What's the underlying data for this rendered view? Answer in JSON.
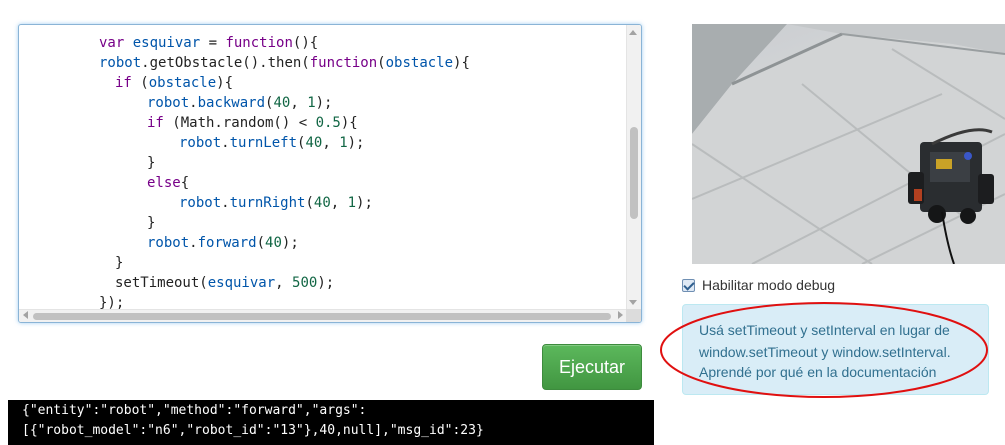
{
  "editor": {
    "lines": [
      [
        [
          "var ",
          "kw"
        ],
        [
          "esquivar",
          "vd"
        ],
        [
          " = ",
          "pl"
        ],
        [
          "function",
          "kw"
        ],
        [
          "(){",
          "pl"
        ]
      ],
      [
        [
          "robot",
          "vn"
        ],
        [
          ".getObstacle().then(",
          "pl"
        ],
        [
          "function",
          "kw"
        ],
        [
          "(",
          "pl"
        ],
        [
          "obstacle",
          "vd"
        ],
        [
          "){",
          "pl"
        ]
      ],
      [
        [
          "if",
          "kw"
        ],
        [
          " (",
          "pl"
        ],
        [
          "obstacle",
          "vn"
        ],
        [
          "){",
          "pl"
        ]
      ],
      [
        [
          "robot",
          "vn"
        ],
        [
          ".",
          "pl"
        ],
        [
          "backward",
          "pr"
        ],
        [
          "(",
          "pl"
        ],
        [
          "40",
          "nm"
        ],
        [
          ", ",
          "pl"
        ],
        [
          "1",
          "nm"
        ],
        [
          ");",
          "pl"
        ]
      ],
      [
        [
          "if",
          "kw"
        ],
        [
          " (Math.random() < ",
          "pl"
        ],
        [
          "0.5",
          "nm"
        ],
        [
          "){",
          "pl"
        ]
      ],
      [
        [
          "robot",
          "vn"
        ],
        [
          ".",
          "pl"
        ],
        [
          "turnLeft",
          "pr"
        ],
        [
          "(",
          "pl"
        ],
        [
          "40",
          "nm"
        ],
        [
          ", ",
          "pl"
        ],
        [
          "1",
          "nm"
        ],
        [
          ");",
          "pl"
        ]
      ],
      [
        [
          "}",
          "pl"
        ]
      ],
      [
        [
          "else",
          "kw"
        ],
        [
          "{",
          "pl"
        ]
      ],
      [
        [
          "robot",
          "vn"
        ],
        [
          ".",
          "pl"
        ],
        [
          "turnRight",
          "pr"
        ],
        [
          "(",
          "pl"
        ],
        [
          "40",
          "nm"
        ],
        [
          ", ",
          "pl"
        ],
        [
          "1",
          "nm"
        ],
        [
          ");",
          "pl"
        ]
      ],
      [
        [
          "}",
          "pl"
        ]
      ],
      [
        [
          "robot",
          "vn"
        ],
        [
          ".",
          "pl"
        ],
        [
          "forward",
          "pr"
        ],
        [
          "(",
          "pl"
        ],
        [
          "40",
          "nm"
        ],
        [
          ");",
          "pl"
        ]
      ],
      [
        [
          "}",
          "pl"
        ]
      ],
      [
        [
          "setTimeout(",
          "pl"
        ],
        [
          "esquivar",
          "vn"
        ],
        [
          ", ",
          "pl"
        ],
        [
          "500",
          "nm"
        ],
        [
          ");",
          "pl"
        ]
      ],
      [
        [
          "});",
          "pl"
        ]
      ]
    ]
  },
  "run_button": {
    "label": "Ejecutar"
  },
  "console": {
    "lines": [
      "{\"entity\":\"robot\",\"method\":\"forward\",\"args\":",
      "[{\"robot_model\":\"n6\",\"robot_id\":\"13\"},40,null],\"msg_id\":23}"
    ]
  },
  "debug": {
    "label": "Habilitar modo debug",
    "checked": true
  },
  "info": {
    "lines": [
      "Usá setTimeout y setInterval en lugar de",
      "window.setTimeout y window.setInterval.",
      "Aprendé por qué en la documentación"
    ]
  }
}
